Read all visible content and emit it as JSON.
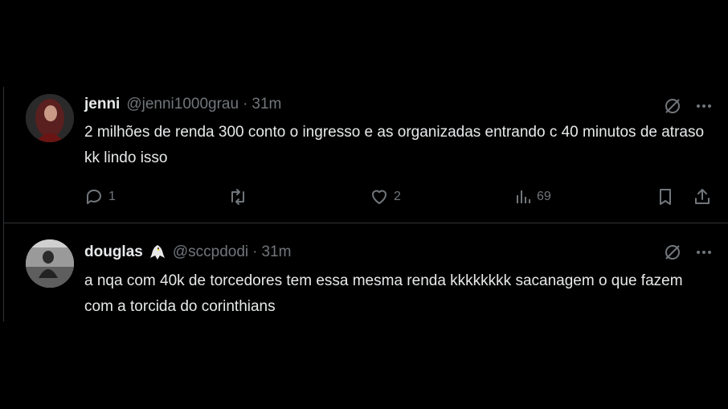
{
  "tweets": [
    {
      "name": "jenni",
      "handle": "@jenni1000grau",
      "separator": "·",
      "time": "31m",
      "text": "2 milhões de renda 300 conto o ingresso e as organizadas entrando c 40 minutos de atraso kk lindo isso",
      "replies": "1",
      "retweets": "",
      "likes": "2",
      "views": "69"
    },
    {
      "name": "douglas",
      "name_icon": "eagle-icon",
      "handle": "@sccpdodi",
      "separator": "·",
      "time": "31m",
      "text": "a nqa com 40k de torcedores tem essa mesma renda kkkkkkkk sacanagem o que fazem com a torcida do corinthians"
    }
  ],
  "colors": {
    "background": "#000000",
    "text": "#e7e9ea",
    "secondary": "#71767b",
    "divider": "#2f3336"
  }
}
